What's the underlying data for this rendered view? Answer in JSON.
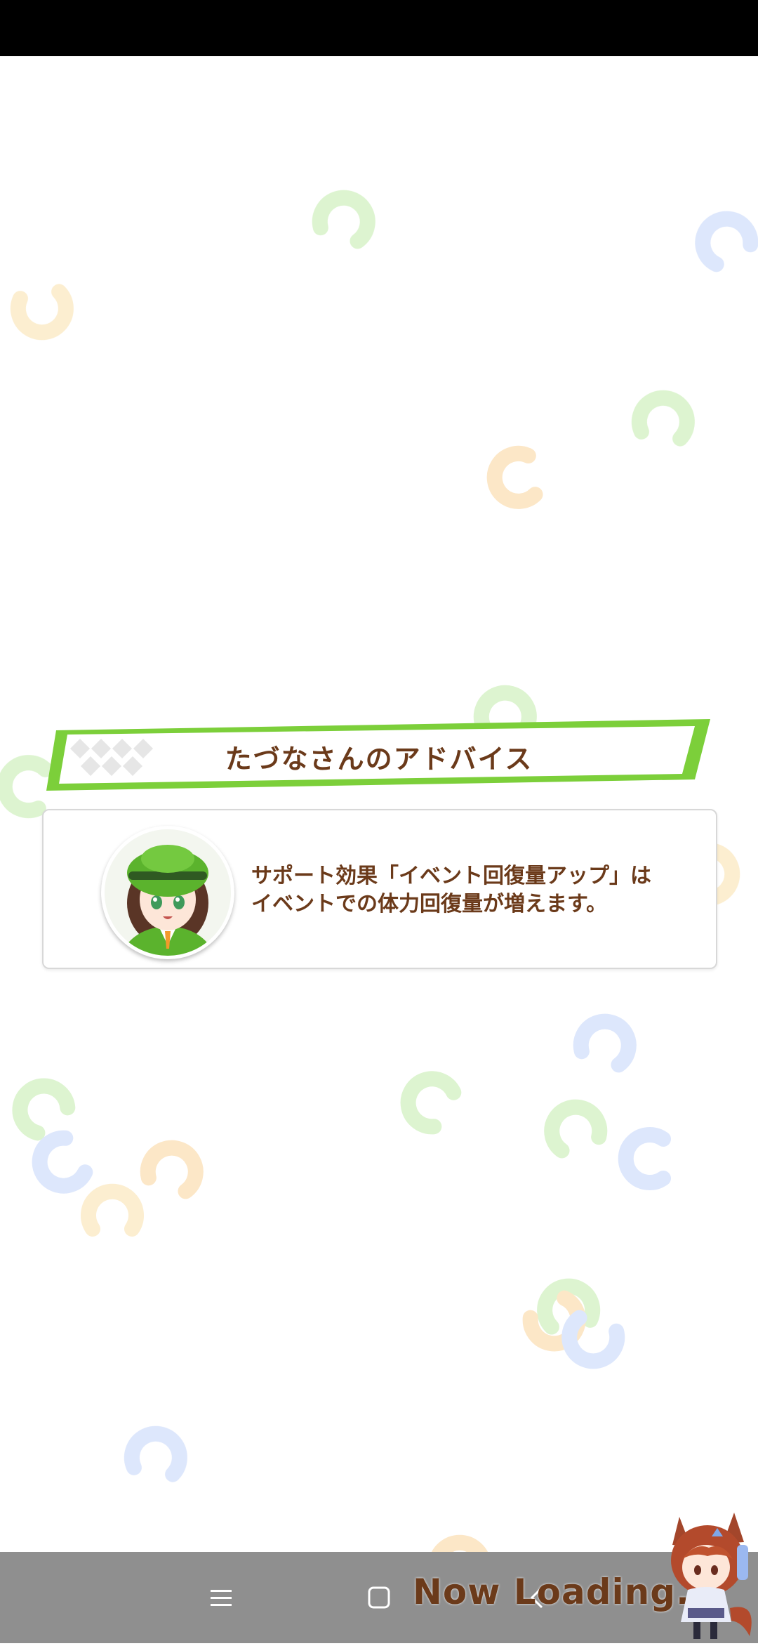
{
  "banner": {
    "title": "たづなさんのアドバイス"
  },
  "advice": {
    "line1": "サポート効果「イベント回復量アップ」は",
    "line2": "イベントでの体力回復量が増えます。"
  },
  "loading": {
    "text": "Now Loading..."
  },
  "icons": {
    "menu": "menu-icon",
    "home": "home-icon",
    "back": "back-icon"
  },
  "colors": {
    "accent_green": "#7ccf3a",
    "text_brown": "#6b3a1a"
  }
}
